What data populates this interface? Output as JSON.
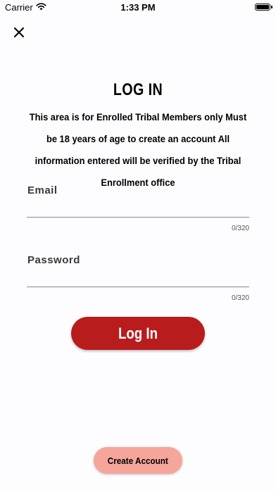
{
  "status_bar": {
    "carrier": "Carrier",
    "time": "1:33 PM",
    "wifi_icon": "wifi-icon",
    "battery_icon": "battery-icon"
  },
  "header": {
    "close_icon": "close-icon"
  },
  "login": {
    "title": "LOG IN",
    "intro": "This area is for Enrolled Tribal Members only Must be 18 years of age to create an account All information entered will be verified by the Tribal Enrollment office",
    "email": {
      "label": "Email",
      "value": "",
      "counter": "0/320"
    },
    "password": {
      "label": "Password",
      "value": "",
      "counter": "0/320"
    },
    "submit_label": "Log In",
    "create_account_label": "Create Account"
  },
  "colors": {
    "primary": "#b91c1c",
    "secondary": "#f6a59b",
    "background": "#fdfcff"
  }
}
